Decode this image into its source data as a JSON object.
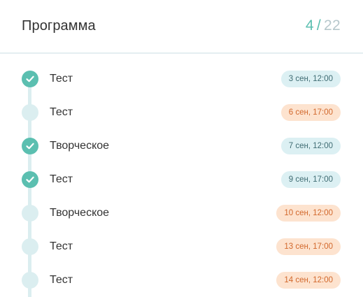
{
  "header": {
    "title": "Программа",
    "progress_done": "4",
    "progress_separator": "/",
    "progress_total": "22"
  },
  "colors": {
    "accent": "#5bbfb0",
    "past_badge_bg": "#dcf0f3",
    "upcoming_badge_bg": "#fde3cf",
    "upcoming_badge_text": "#d2682c"
  },
  "items": [
    {
      "label": "Тест",
      "date": "3 сен, 12:00",
      "completed": true,
      "status": "past"
    },
    {
      "label": "Тест",
      "date": "6 сен, 17:00",
      "completed": false,
      "status": "upcoming"
    },
    {
      "label": "Творческое",
      "date": "7 сен, 12:00",
      "completed": true,
      "status": "past"
    },
    {
      "label": "Тест",
      "date": "9 сен, 17:00",
      "completed": true,
      "status": "past"
    },
    {
      "label": "Творческое",
      "date": "10 сен, 12:00",
      "completed": false,
      "status": "upcoming"
    },
    {
      "label": "Тест",
      "date": "13 сен, 17:00",
      "completed": false,
      "status": "upcoming"
    },
    {
      "label": "Тест",
      "date": "14 сен, 12:00",
      "completed": false,
      "status": "upcoming"
    }
  ]
}
